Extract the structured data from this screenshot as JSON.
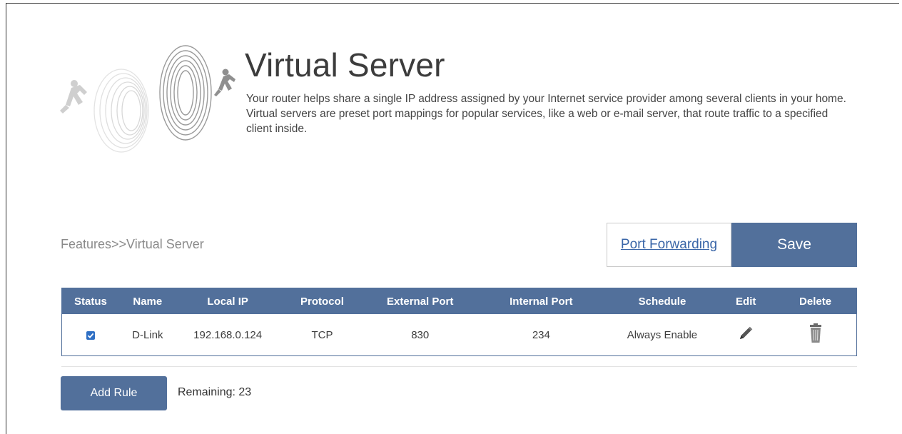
{
  "header": {
    "title": "Virtual Server",
    "description": "Your router helps share a single IP address assigned by your Internet service provider among several clients in your home. Virtual servers are preset port mappings for popular services, like a web or e-mail server, that route traffic to a specified client inside."
  },
  "breadcrumb": "Features>>Virtual Server",
  "actions": {
    "port_forwarding_label": "Port Forwarding",
    "save_label": "Save"
  },
  "table": {
    "headers": {
      "status": "Status",
      "name": "Name",
      "local_ip": "Local IP",
      "protocol": "Protocol",
      "external_port": "External Port",
      "internal_port": "Internal Port",
      "schedule": "Schedule",
      "edit": "Edit",
      "delete": "Delete"
    },
    "rows": [
      {
        "status_checked": true,
        "name": "D-Link",
        "local_ip": "192.168.0.124",
        "protocol": "TCP",
        "external_port": "830",
        "internal_port": "234",
        "schedule": "Always Enable"
      }
    ]
  },
  "footer": {
    "add_rule_label": "Add Rule",
    "remaining": "Remaining: 23"
  },
  "colors": {
    "accent": "#52709b",
    "link": "#3a66a8",
    "checkbox": "#2f6fc4"
  }
}
